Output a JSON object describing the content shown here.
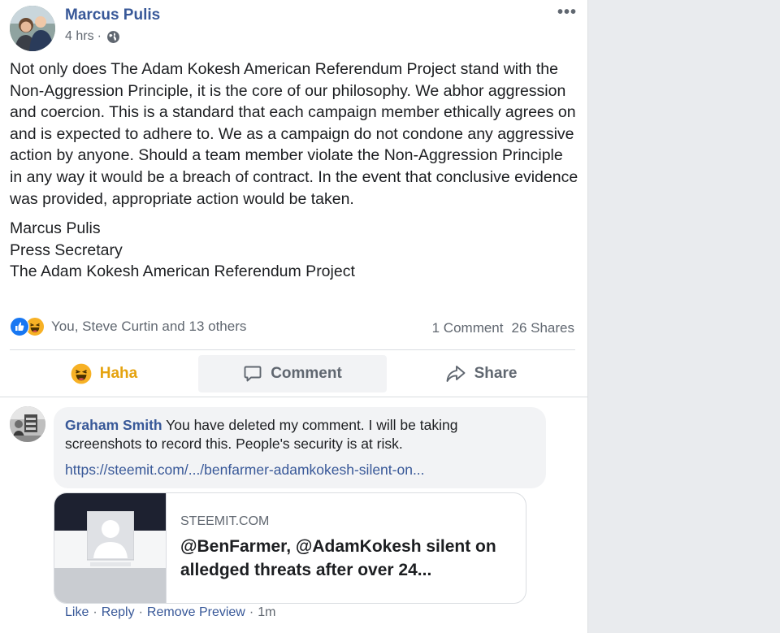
{
  "post": {
    "author": "Marcus Pulis",
    "time": "4 hrs",
    "separator": "·",
    "more": "•••",
    "paragraph": "Not only does The Adam Kokesh American Referendum Project stand with the Non-Aggression Principle, it is the core of our philosophy. We abhor aggression and coercion. This is a standard that each campaign member ethically agrees on and is expected to adhere to. We as a campaign do not condone any aggressive action by anyone. Should a team member violate the Non-Aggression Principle in any way it would be a breach of contract. In the event that conclusive evidence was provided, appropriate action would be taken.",
    "signature": {
      "line1": "Marcus Pulis",
      "line2": "Press Secretary",
      "line3": "The Adam Kokesh American Referendum Project"
    }
  },
  "reactions": {
    "names": "You, Steve Curtin and 13 others",
    "comments": "1 Comment",
    "shares": "26 Shares"
  },
  "actions": {
    "haha": "Haha",
    "comment": "Comment",
    "share": "Share"
  },
  "comment": {
    "name": "Graham Smith",
    "text": "You have deleted my comment. I will be taking screenshots to record this. People's security is at risk.",
    "link": "https://steemit.com/.../benfarmer-adamkokesh-silent-on...",
    "preview": {
      "domain": "STEEMIT.COM",
      "title": "@BenFarmer, @AdamKokesh silent on alledged threats after over 24..."
    },
    "footer": {
      "like": "Like",
      "reply": "Reply",
      "remove": "Remove Preview",
      "time": "1m",
      "dot": "·"
    }
  },
  "colors": {
    "link_blue": "#385898",
    "meta_gray": "#606770",
    "like_blue": "#1877f2",
    "haha_yellow": "#f7b125",
    "sidebar_bg": "#e9ebee"
  }
}
